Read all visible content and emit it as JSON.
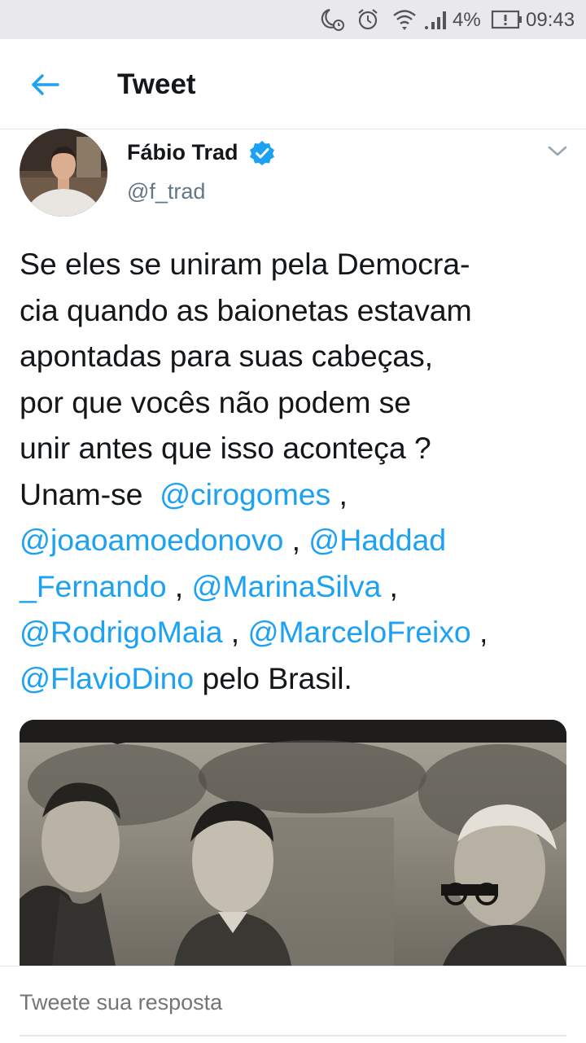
{
  "status_bar": {
    "battery_percent": "4%",
    "time": "09:43",
    "icons": [
      "moon-alarm-icon",
      "alarm-clock-icon",
      "wifi-icon",
      "signal-icon",
      "battery-alert-icon"
    ]
  },
  "header": {
    "title": "Tweet",
    "back_icon": "arrow-left-icon"
  },
  "tweet": {
    "author_name": "Fábio Trad",
    "author_handle": "@f_trad",
    "verified": true,
    "lines": [
      [
        {
          "text": "Se eles se uniram pela Democra-"
        }
      ],
      [
        {
          "text": "cia quando as baionetas estavam"
        }
      ],
      [
        {
          "text": "apontadas para suas cabeças,"
        }
      ],
      [
        {
          "text": "por que vocês não podem se"
        }
      ],
      [
        {
          "text": "unir antes que isso aconteça ?"
        }
      ],
      [
        {
          "text": "Unam-se  "
        },
        {
          "text": "@cirogomes",
          "mention": true
        },
        {
          "text": " ,"
        }
      ],
      [
        {
          "text": "@joaoamoedonovo",
          "mention": true
        },
        {
          "text": " , "
        },
        {
          "text": "@Haddad",
          "mention": true
        }
      ],
      [
        {
          "text": "_Fernando",
          "mention": true
        },
        {
          "text": " , "
        },
        {
          "text": "@MarinaSilva",
          "mention": true
        },
        {
          "text": " ,"
        }
      ],
      [
        {
          "text": "@RodrigoMaia",
          "mention": true
        },
        {
          "text": " , "
        },
        {
          "text": "@MarceloFreixo",
          "mention": true
        },
        {
          "text": " ,"
        }
      ],
      [
        {
          "text": "@FlavioDino",
          "mention": true
        },
        {
          "text": " pelo Brasil."
        }
      ]
    ]
  },
  "reply": {
    "placeholder": "Tweete sua resposta"
  },
  "colors": {
    "accent": "#1da1f2",
    "text": "#14171a",
    "secondary_text": "#657786",
    "divider": "#e1e8ed",
    "status_bar_bg": "#e9e9ec"
  }
}
